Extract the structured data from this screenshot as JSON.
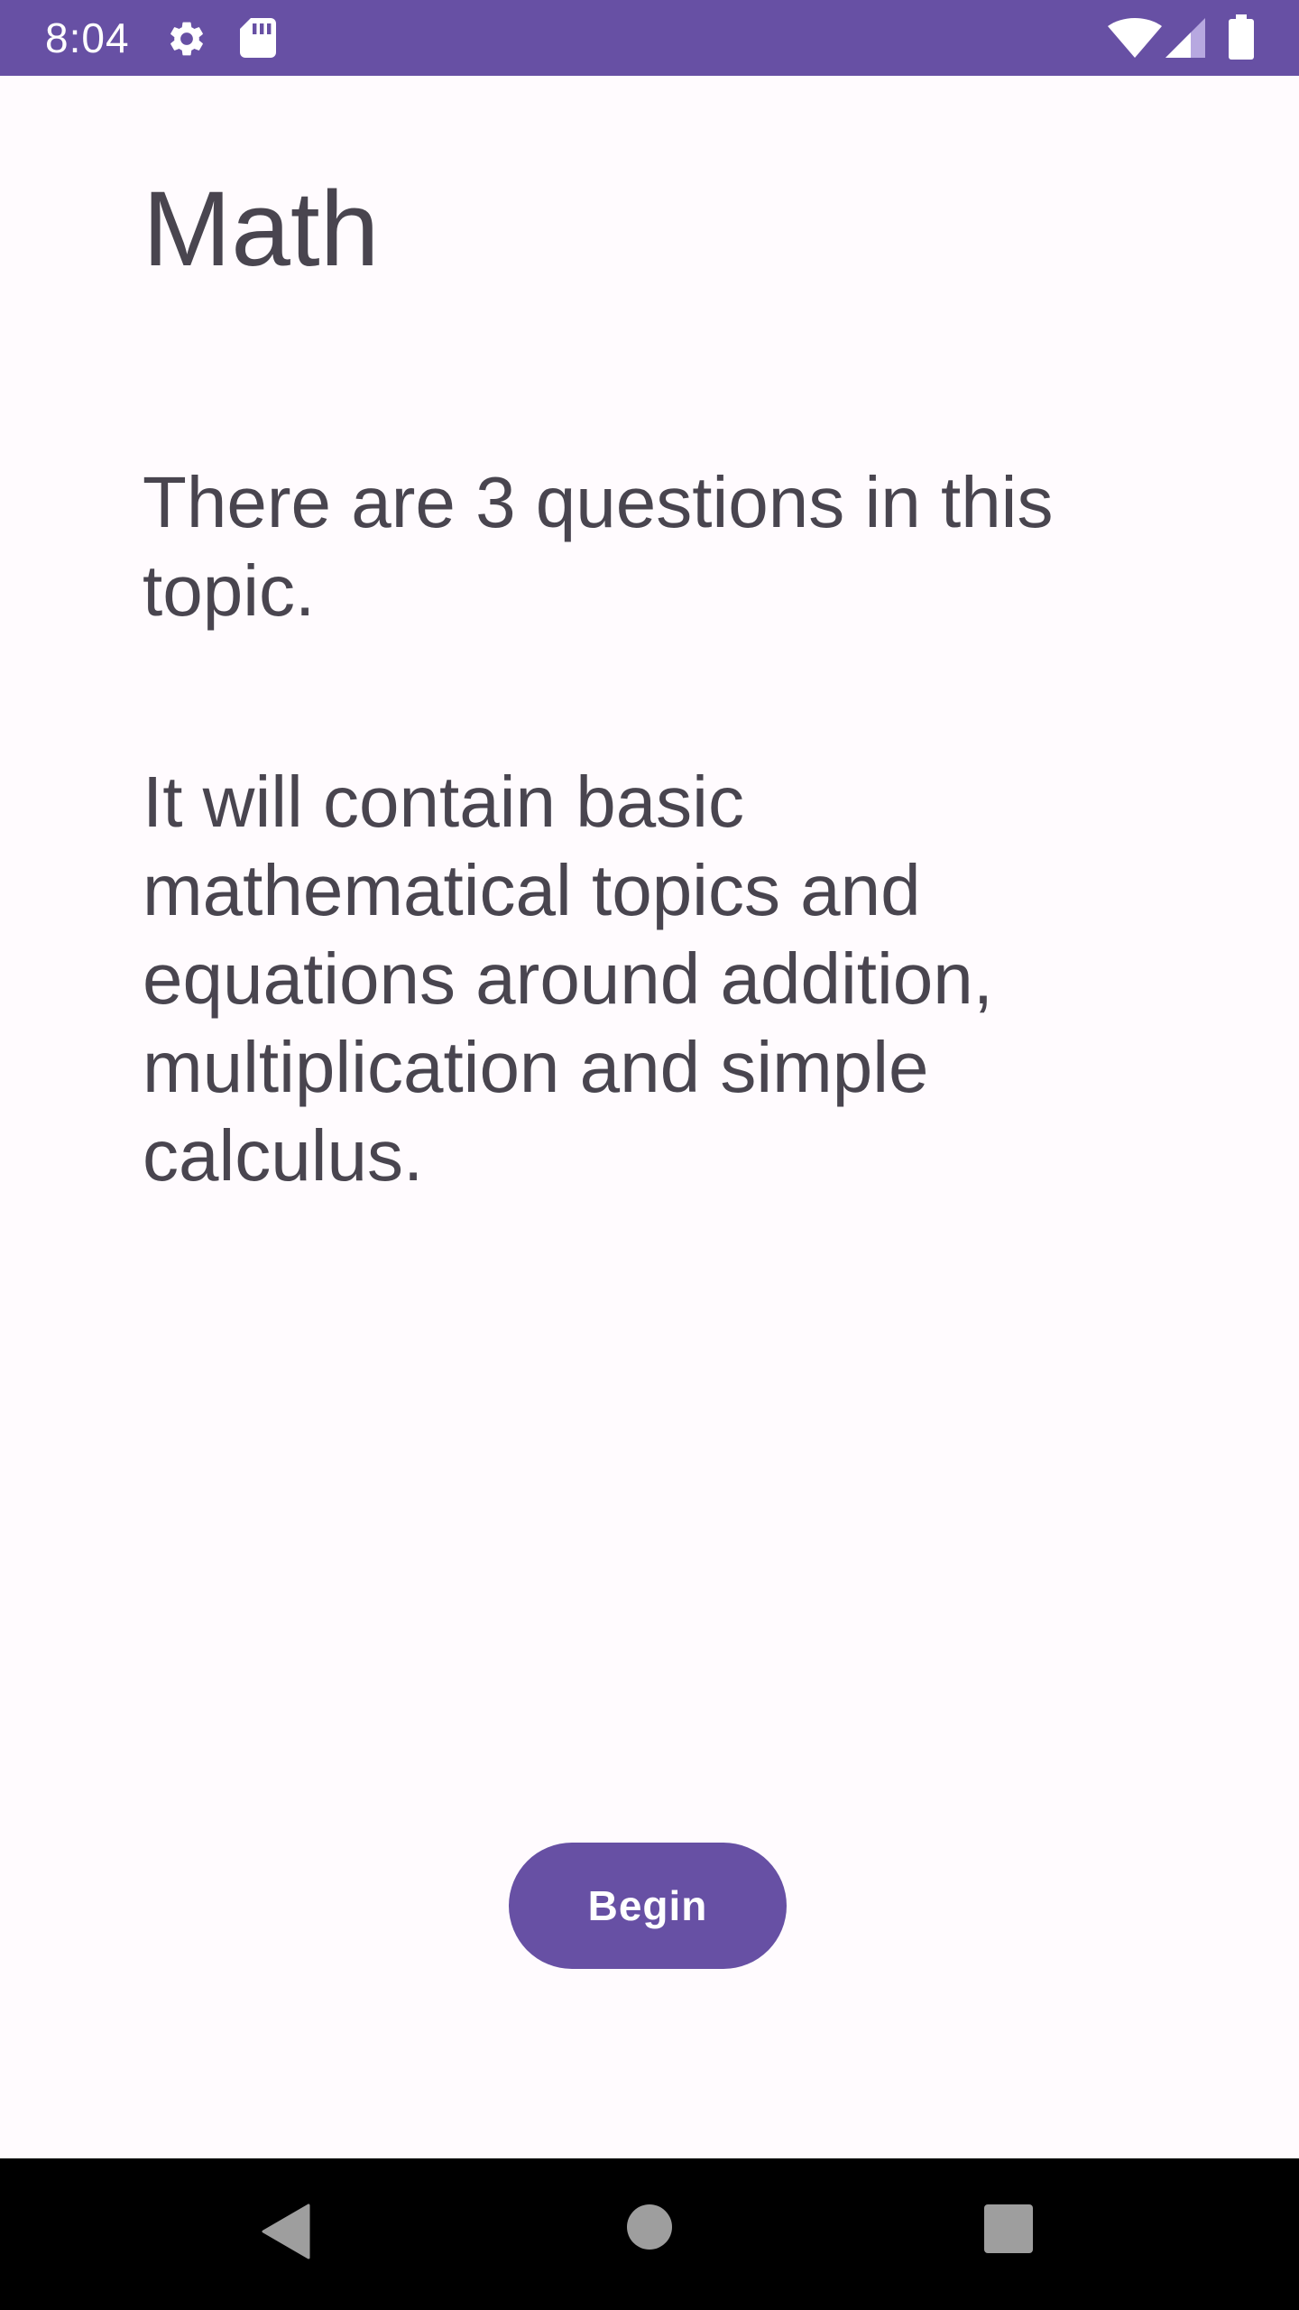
{
  "status_bar": {
    "time": "8:04",
    "background": "#6750A4",
    "icons": [
      "gear-icon",
      "sd-card-icon",
      "wifi-icon",
      "signal-icon",
      "battery-icon"
    ]
  },
  "screen": {
    "title": "Math",
    "question_count_text": "There are 3 questions in this topic.",
    "description": "It will contain basic mathematical topics and equations around addition, multiplication and simple calculus.",
    "begin_label": "Begin"
  },
  "nav_bar": {
    "buttons": [
      "back-icon",
      "home-icon",
      "recents-icon"
    ]
  },
  "colors": {
    "accent": "#6750A4",
    "background": "#FFFBFE",
    "text": "#49454F"
  }
}
